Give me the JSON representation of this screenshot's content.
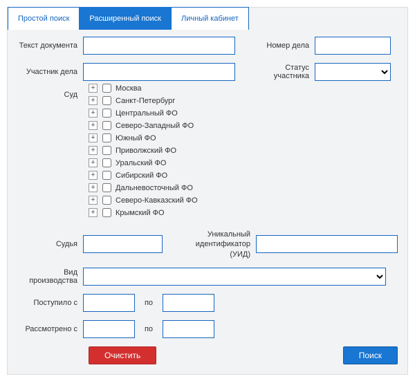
{
  "tabs": {
    "simple": "Простой поиск",
    "advanced": "Расширенный поиск",
    "cabinet": "Личный кабинет"
  },
  "labels": {
    "doc_text": "Текст документа",
    "case_no": "Номер дела",
    "participant": "Участник дела",
    "participant_status": "Статус участника",
    "court": "Суд",
    "judge": "Судья",
    "uid": "Уникальный идентификатор (УИД)",
    "proc_type": "Вид производства",
    "received_from": "Поступило с",
    "reviewed_from": "Рассмотрено с",
    "to": "по"
  },
  "court_tree": [
    "Москва",
    "Санкт-Петербург",
    "Центральный ФО",
    "Северо-Западный ФО",
    "Южный ФО",
    "Приволжский ФО",
    "Уральский ФО",
    "Сибирский ФО",
    "Дальневосточный ФО",
    "Северо-Кавказский ФО",
    "Крымский ФО"
  ],
  "buttons": {
    "clear": "Очистить",
    "search": "Поиск"
  }
}
